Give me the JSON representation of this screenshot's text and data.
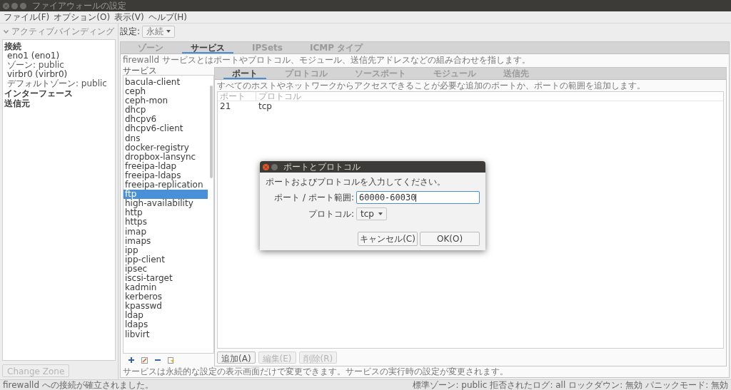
{
  "window": {
    "title": "ファイアウォールの設定"
  },
  "menu": [
    "ファイル(F)",
    "オプション(O)",
    "表示(V)",
    "ヘルプ(H)"
  ],
  "bindings": {
    "header": "アクティブバインディング",
    "expanded": true,
    "sections": [
      {
        "label": "接続",
        "items": [
          {
            "name": "eno1 (eno1)",
            "sub": "ゾーン: public"
          },
          {
            "name": "virbr0 (virbr0)",
            "sub": "デフォルトゾーン: public"
          }
        ]
      },
      {
        "label": "インターフェース"
      },
      {
        "label": "送信元"
      }
    ],
    "button": {
      "label": "Change Zone",
      "disabled": true
    }
  },
  "settings": {
    "label": "設定:",
    "value": "永続"
  },
  "tabs": [
    {
      "label": "ゾーン",
      "selected": false
    },
    {
      "label": "サービス",
      "selected": true
    },
    {
      "label": "IPSets",
      "selected": false
    },
    {
      "label": "ICMP タイプ",
      "selected": false
    }
  ],
  "description": "firewalld サービスとはポートやプロトコル、モジュール、送信先アドレスなどの組み合わせを指します。",
  "services": {
    "label": "サービス",
    "items": [
      {
        "name": "bacula-client",
        "selected": false
      },
      {
        "name": "ceph",
        "selected": false
      },
      {
        "name": "ceph-mon",
        "selected": false
      },
      {
        "name": "dhcp",
        "selected": false
      },
      {
        "name": "dhcpv6",
        "selected": false
      },
      {
        "name": "dhcpv6-client",
        "selected": false
      },
      {
        "name": "dns",
        "selected": false
      },
      {
        "name": "docker-registry",
        "selected": false
      },
      {
        "name": "dropbox-lansync",
        "selected": false
      },
      {
        "name": "freeipa-ldap",
        "selected": false
      },
      {
        "name": "freeipa-ldaps",
        "selected": false
      },
      {
        "name": "freeipa-replication",
        "selected": false
      },
      {
        "name": "ftp",
        "selected": true
      },
      {
        "name": "high-availability",
        "selected": false
      },
      {
        "name": "http",
        "selected": false
      },
      {
        "name": "https",
        "selected": false
      },
      {
        "name": "imap",
        "selected": false
      },
      {
        "name": "imaps",
        "selected": false
      },
      {
        "name": "ipp",
        "selected": false
      },
      {
        "name": "ipp-client",
        "selected": false
      },
      {
        "name": "ipsec",
        "selected": false
      },
      {
        "name": "iscsi-target",
        "selected": false
      },
      {
        "name": "kadmin",
        "selected": false
      },
      {
        "name": "kerberos",
        "selected": false
      },
      {
        "name": "kpasswd",
        "selected": false
      },
      {
        "name": "ldap",
        "selected": false
      },
      {
        "name": "ldaps",
        "selected": false
      },
      {
        "name": "libvirt",
        "selected": false
      }
    ]
  },
  "service_tabs": [
    {
      "label": "ポート",
      "selected": true
    },
    {
      "label": "プロトコル",
      "selected": false
    },
    {
      "label": "ソースポート",
      "selected": false
    },
    {
      "label": "モジュール",
      "selected": false
    },
    {
      "label": "送信先",
      "selected": false
    }
  ],
  "port_description": "すべてのホストやネットワークからアクセスできることが必要な追加のポートか、ポートの範囲を追加します。",
  "ports_table": {
    "columns": [
      "ポート",
      "プロトコル"
    ],
    "rows": [
      [
        "21",
        "tcp"
      ]
    ]
  },
  "port_buttons": [
    {
      "label": "追加(A)",
      "disabled": false
    },
    {
      "label": "編集(E)",
      "disabled": true
    },
    {
      "label": "削除(R)",
      "disabled": true
    }
  ],
  "footer_note": "サービスは永続的な設定の表示画面だけで変更できます。サービスの実行時の設定が変更されます。",
  "status_bar": {
    "message": "firewalld への接続が確立されました。",
    "items": [
      "標準ゾーン: public",
      "拒否されたログ: all",
      "ロックダウン: 無効",
      "パニックモード: 無効"
    ]
  },
  "dialog": {
    "title": "ポートとプロトコル",
    "prompt": "ポートおよびプロトコルを入力してください。",
    "port_label": "ポート / ポート範囲:",
    "port_value": "60000-60030",
    "protocol_label": "プロトコル:",
    "protocol_value": "tcp",
    "buttons": [
      "キャンセル(C)",
      "OK(O)"
    ]
  }
}
